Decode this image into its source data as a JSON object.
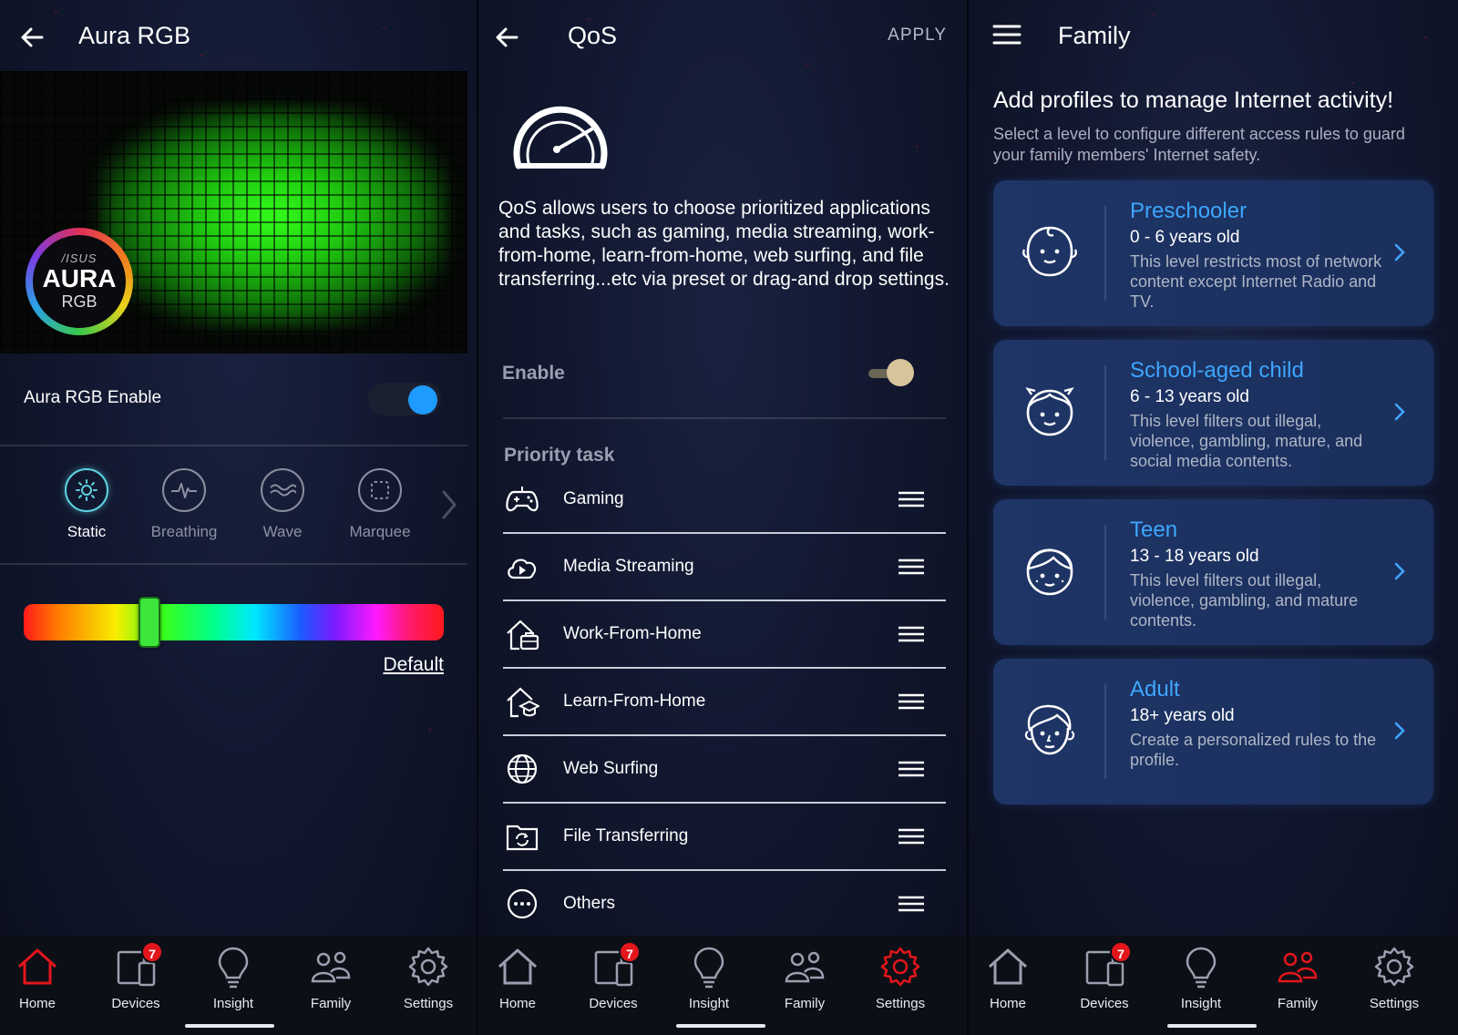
{
  "colors": {
    "accent_red": "#e4161c",
    "toggle_blue": "#1e9bff",
    "toggle_gold": "#d8c49a",
    "link_blue": "#3ea6ff",
    "static_cyan": "#5cd2e0"
  },
  "aura": {
    "title": "Aura RGB",
    "logo_brand": "/ISUS",
    "logo_big": "AURA",
    "logo_small": "RGB",
    "enable_label": "Aura RGB Enable",
    "enabled": true,
    "modes": [
      {
        "label": "Static",
        "icon": "sun-icon",
        "active": true
      },
      {
        "label": "Breathing",
        "icon": "pulse-icon",
        "active": false
      },
      {
        "label": "Wave",
        "icon": "wave-icon",
        "active": false
      },
      {
        "label": "Marquee",
        "icon": "marquee-icon",
        "active": false
      }
    ],
    "hue_position": 0.3,
    "default_label": "Default"
  },
  "qos": {
    "title": "QoS",
    "apply_label": "APPLY",
    "description": "QoS allows users to choose prioritized applications and tasks, such as gaming, media streaming, work-from-home, learn-from-home, web surfing, and file transferring...etc via preset or drag-and drop settings.",
    "enable_label": "Enable",
    "enabled": true,
    "priority_title": "Priority task",
    "tasks": [
      {
        "label": "Gaming",
        "icon": "gamepad-icon"
      },
      {
        "label": "Media Streaming",
        "icon": "cloud-play-icon"
      },
      {
        "label": "Work-From-Home",
        "icon": "house-briefcase-icon"
      },
      {
        "label": "Learn-From-Home",
        "icon": "house-graduation-icon"
      },
      {
        "label": "Web Surfing",
        "icon": "globe-icon"
      },
      {
        "label": "File Transferring",
        "icon": "folder-sync-icon"
      },
      {
        "label": "Others",
        "icon": "more-dots-icon"
      }
    ]
  },
  "family": {
    "title": "Family",
    "heading": "Add profiles to manage Internet activity!",
    "subheading": "Select a level to configure different access rules to guard your family members' Internet safety.",
    "profiles": [
      {
        "title": "Preschooler",
        "age": "0 - 6 years old",
        "desc": "This level restricts most of network content except Internet Radio and TV.",
        "icon": "baby-face-icon"
      },
      {
        "title": "School-aged child",
        "age": "6 - 13 years old",
        "desc": "This level filters out illegal, violence, gambling, mature, and social media contents.",
        "icon": "child-face-icon"
      },
      {
        "title": "Teen",
        "age": "13 - 18 years old",
        "desc": "This level filters out illegal, violence, gambling, and mature contents.",
        "icon": "teen-face-icon"
      },
      {
        "title": "Adult",
        "age": "18+ years old",
        "desc": "Create a personalized rules to the profile.",
        "icon": "adult-face-icon"
      }
    ]
  },
  "nav": {
    "items": [
      {
        "label": "Home",
        "icon": "home-icon"
      },
      {
        "label": "Devices",
        "icon": "devices-icon",
        "badge": "7"
      },
      {
        "label": "Insight",
        "icon": "lightbulb-icon"
      },
      {
        "label": "Family",
        "icon": "family-icon"
      },
      {
        "label": "Settings",
        "icon": "gear-icon"
      }
    ],
    "active_per_panel": [
      "Home",
      "Settings",
      "Family"
    ]
  }
}
